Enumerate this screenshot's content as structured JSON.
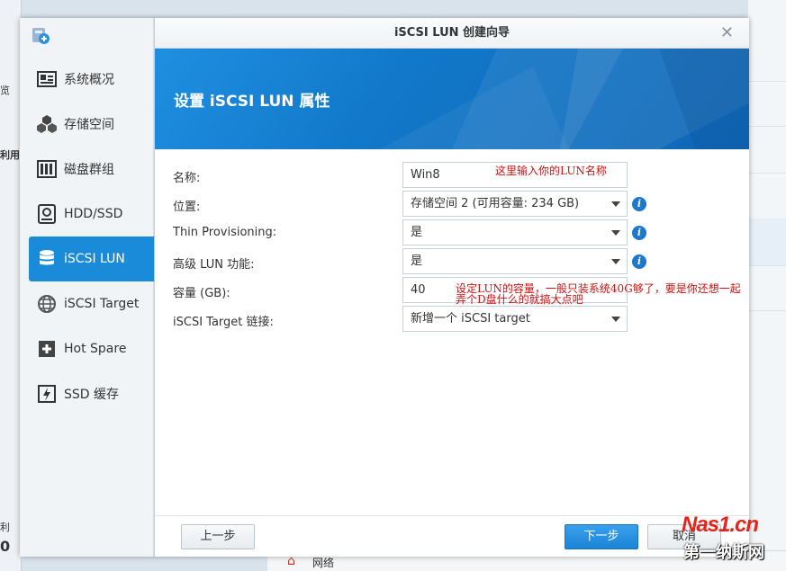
{
  "background": {
    "left_fragments": [
      "览",
      "利用",
      "利",
      "0"
    ],
    "bottom_item": "网络"
  },
  "sidebar": {
    "items": [
      {
        "label": "系统概况",
        "icon": "overview-icon",
        "active": false
      },
      {
        "label": "存储空间",
        "icon": "cubes-icon",
        "active": false
      },
      {
        "label": "磁盘群组",
        "icon": "disk-group-icon",
        "active": false
      },
      {
        "label": "HDD/SSD",
        "icon": "hdd-icon",
        "active": false
      },
      {
        "label": "iSCSI LUN",
        "icon": "database-icon",
        "active": true
      },
      {
        "label": "iSCSI Target",
        "icon": "globe-icon",
        "active": false
      },
      {
        "label": "Hot Spare",
        "icon": "plus-box-icon",
        "active": false
      },
      {
        "label": "SSD 缓存",
        "icon": "ssd-cache-icon",
        "active": false
      }
    ]
  },
  "dialog": {
    "title": "iSCSI LUN 创建向导",
    "banner_title": "设置 iSCSI LUN 属性",
    "fields": {
      "name": {
        "label": "名称:",
        "value": "Win8"
      },
      "location": {
        "label": "位置:",
        "value": "存储空间 2 (可用容量: 234 GB)"
      },
      "thin": {
        "label": "Thin Provisioning:",
        "value": "是"
      },
      "advanced": {
        "label": "高级 LUN 功能:",
        "value": "是"
      },
      "capacity": {
        "label": "容量 (GB):",
        "value": "40"
      },
      "target": {
        "label": "iSCSI Target 链接:",
        "value": "新增一个 iSCSI target"
      }
    },
    "notes": {
      "name_note": "这里输入你的LUN名称",
      "capacity_note_1": "设定LUN的容量，一般只装系统40G够了，要是你还想一起",
      "capacity_note_2": "弄个D盘什么的就搞大点吧"
    },
    "buttons": {
      "prev": "上一步",
      "next": "下一步",
      "cancel": "取消"
    }
  },
  "watermark": {
    "line1": "Nas1.cn",
    "line2": "第一纳斯网"
  },
  "colors": {
    "accent": "#1a8bd8",
    "annotation": "#cc1111"
  }
}
